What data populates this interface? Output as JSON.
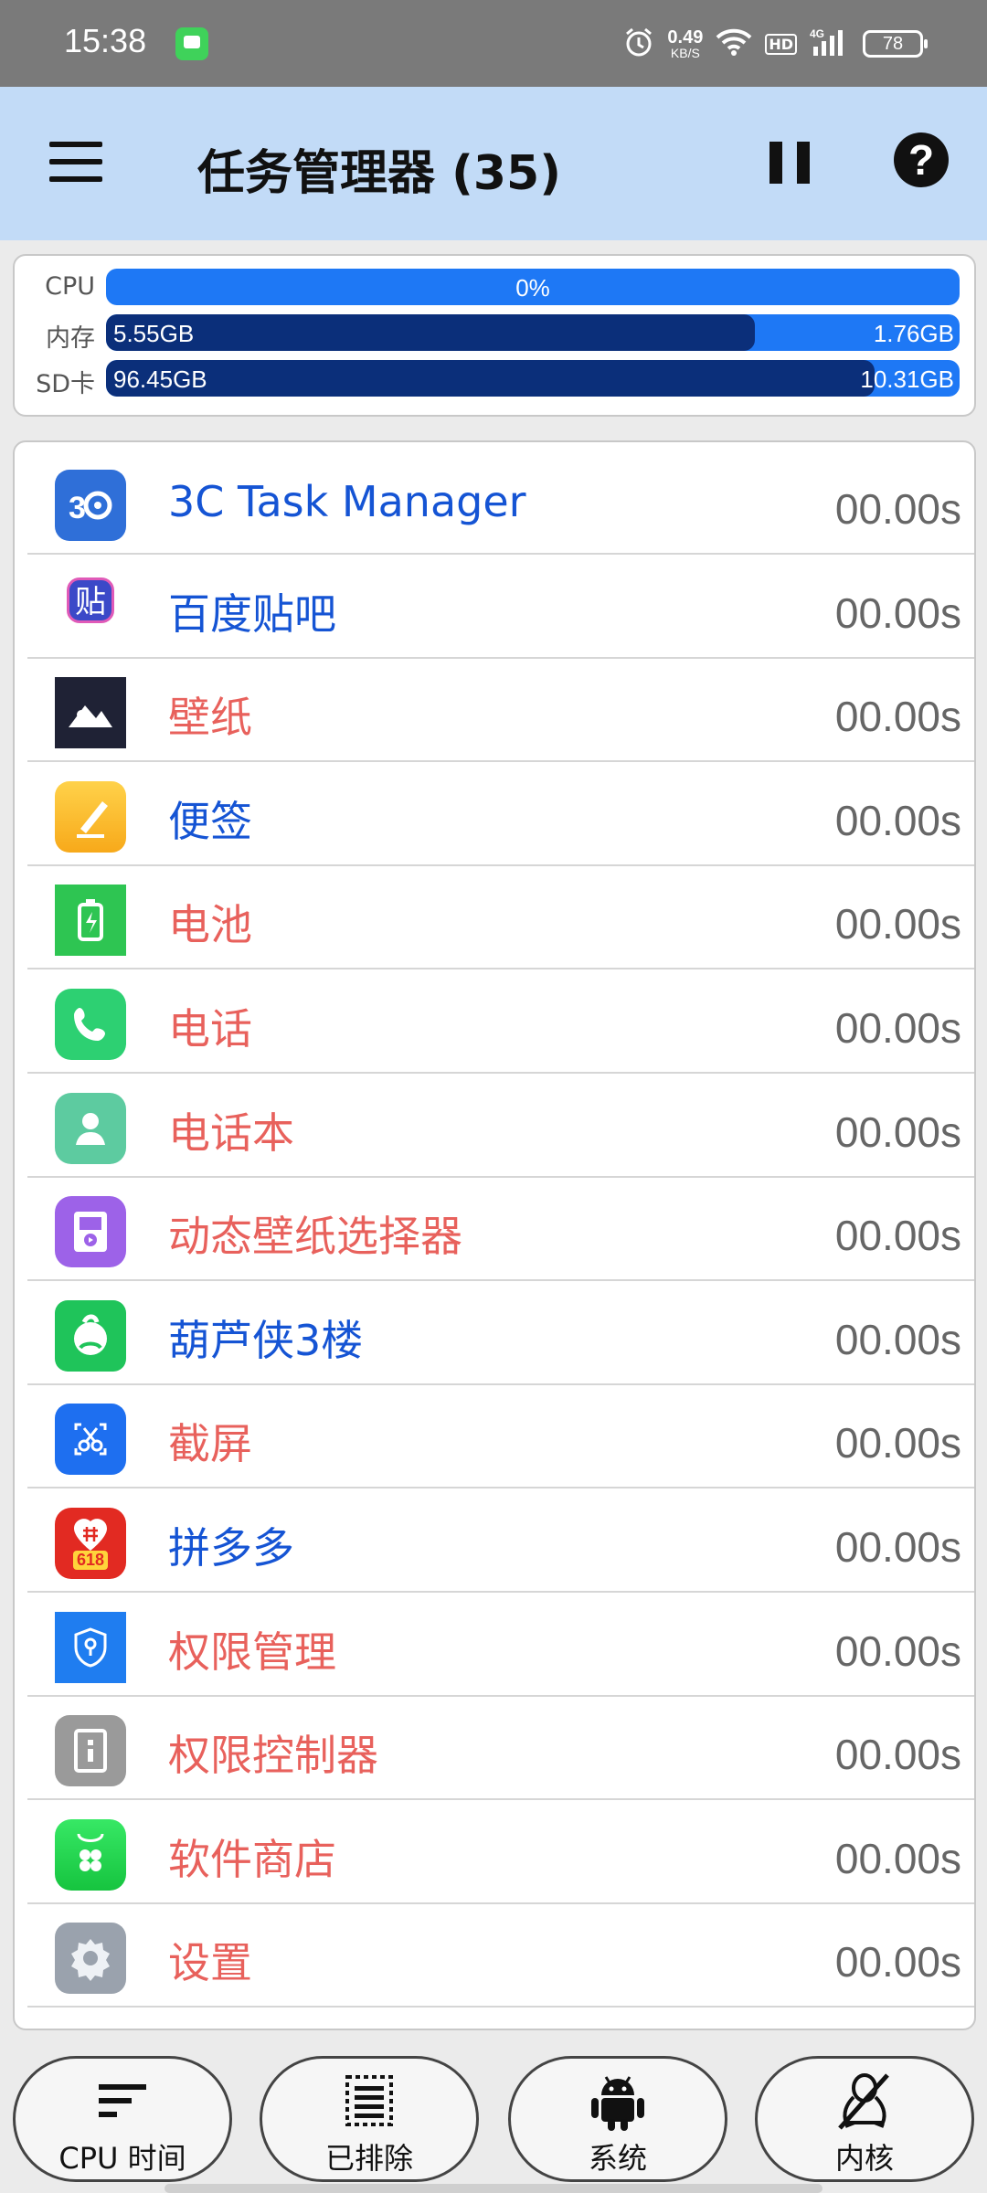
{
  "status_bar": {
    "time": "15:38",
    "speed_value": "0.49",
    "speed_unit": "KB/S",
    "hd": "HD",
    "network": "4G",
    "battery": "78"
  },
  "app_bar": {
    "title": "任务管理器 (35)",
    "help_symbol": "?"
  },
  "stats": {
    "cpu": {
      "label": "CPU",
      "value": "0%",
      "fraction": 0.0
    },
    "memory": {
      "label": "内存",
      "used": "5.55GB",
      "free": "1.76GB",
      "fraction": 0.76
    },
    "sd": {
      "label": "SD卡",
      "used": "96.45GB",
      "free": "10.31GB",
      "fraction": 0.9
    }
  },
  "processes": [
    {
      "name": "3C Task Manager",
      "time": "00.00s",
      "color": "#1554d4",
      "icon": "3c-task-manager-icon"
    },
    {
      "name": "百度贴吧",
      "time": "00.00s",
      "color": "#1554d4",
      "icon": "baidu-tieba-icon",
      "icon_text": "贴"
    },
    {
      "name": "壁纸",
      "time": "00.00s",
      "color": "#e8615c",
      "icon": "wallpaper-icon"
    },
    {
      "name": "便签",
      "time": "00.00s",
      "color": "#1554d4",
      "icon": "notes-icon"
    },
    {
      "name": "电池",
      "time": "00.00s",
      "color": "#e8615c",
      "icon": "battery-icon"
    },
    {
      "name": "电话",
      "time": "00.00s",
      "color": "#e8615c",
      "icon": "phone-icon"
    },
    {
      "name": "电话本",
      "time": "00.00s",
      "color": "#e8615c",
      "icon": "contacts-icon"
    },
    {
      "name": "动态壁纸选择器",
      "time": "00.00s",
      "color": "#e8615c",
      "icon": "live-wallpaper-icon"
    },
    {
      "name": "葫芦侠3楼",
      "time": "00.00s",
      "color": "#1554d4",
      "icon": "huluxia-icon"
    },
    {
      "name": "截屏",
      "time": "00.00s",
      "color": "#e8615c",
      "icon": "screenshot-icon"
    },
    {
      "name": "拼多多",
      "time": "00.00s",
      "color": "#1554d4",
      "icon": "pinduoduo-icon",
      "icon_text": "618"
    },
    {
      "name": "权限管理",
      "time": "00.00s",
      "color": "#e8615c",
      "icon": "permission-manager-icon"
    },
    {
      "name": "权限控制器",
      "time": "00.00s",
      "color": "#e8615c",
      "icon": "permission-controller-icon"
    },
    {
      "name": "软件商店",
      "time": "00.00s",
      "color": "#e8615c",
      "icon": "app-store-icon"
    },
    {
      "name": "设置",
      "time": "00.00s",
      "color": "#e8615c",
      "icon": "settings-icon"
    }
  ],
  "bottom_nav": [
    {
      "label": "CPU 时间",
      "icon": "sort-lines-icon"
    },
    {
      "label": "已排除",
      "icon": "excluded-list-icon"
    },
    {
      "label": "系统",
      "icon": "android-icon"
    },
    {
      "label": "内核",
      "icon": "linux-penguin-crossed-icon"
    }
  ]
}
